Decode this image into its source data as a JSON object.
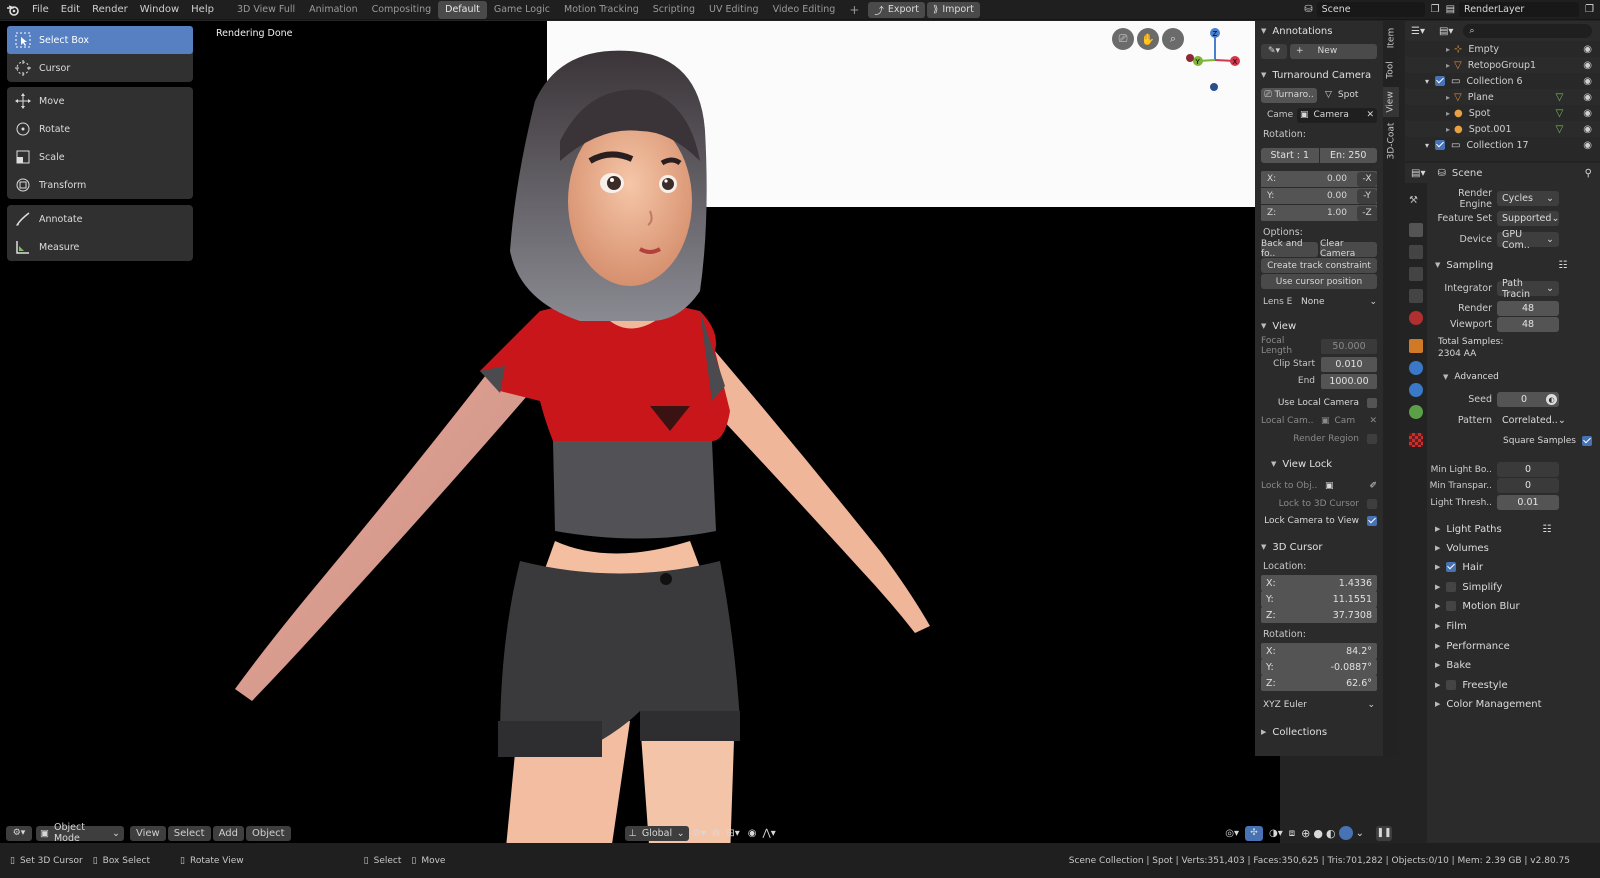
{
  "menu": [
    "File",
    "Edit",
    "Render",
    "Window",
    "Help"
  ],
  "workspaces": [
    {
      "label": "3D View Full",
      "active": false
    },
    {
      "label": "Animation",
      "active": false
    },
    {
      "label": "Compositing",
      "active": false
    },
    {
      "label": "Default",
      "active": true
    },
    {
      "label": "Game Logic",
      "active": false
    },
    {
      "label": "Motion Tracking",
      "active": false
    },
    {
      "label": "Scripting",
      "active": false
    },
    {
      "label": "UV Editing",
      "active": false
    },
    {
      "label": "Video Editing",
      "active": false
    }
  ],
  "topbar": {
    "add_tab": "+",
    "export": "Export",
    "import": "Import",
    "scene": "Scene",
    "render_layer": "RenderLayer"
  },
  "viewport": {
    "status": "Rendering Done"
  },
  "tools": {
    "group1": [
      "Select Box",
      "Cursor"
    ],
    "group2": [
      "Move",
      "Rotate",
      "Scale",
      "Transform"
    ],
    "group3": [
      "Annotate",
      "Measure"
    ]
  },
  "npanel": {
    "annotations": {
      "title": "Annotations",
      "new": "New"
    },
    "turnaround": {
      "title": "Turnaround Camera",
      "obj": "Turnaro..",
      "spot": "Spot",
      "came_label": "Came",
      "camera": "Camera",
      "rotation": "Rotation:",
      "start": "Start : 1",
      "end": "En: 250",
      "rx": {
        "label": "X:",
        "value": "0.00",
        "btn": "-X"
      },
      "ry": {
        "label": "Y:",
        "value": "0.00",
        "btn": "-Y"
      },
      "rz": {
        "label": "Z:",
        "value": "1.00",
        "btn": "-Z"
      },
      "options": "Options:",
      "back": "Back and fo..",
      "clear": "Clear Camera",
      "track": "Create track constraint",
      "cursor": "Use cursor position",
      "lens_label": "Lens E",
      "lens_value": "None"
    },
    "view": {
      "title": "View",
      "focal_label": "Focal Length",
      "focal": "50.000",
      "clip_start_label": "Clip Start",
      "clip_start": "0.010",
      "end_label": "End",
      "end": "1000.00",
      "use_local": "Use Local Camera",
      "local_cam_label": "Local Cam..",
      "local_cam": "Cam",
      "render_region": "Render Region"
    },
    "viewlock": {
      "title": "View Lock",
      "lock_obj": "Lock to Obj..",
      "lock_3d": "Lock to 3D Cursor",
      "lock_cam": "Lock Camera to View"
    },
    "cursor3d": {
      "title": "3D Cursor",
      "location": "Location:",
      "lx": {
        "label": "X:",
        "value": "1.4336"
      },
      "ly": {
        "label": "Y:",
        "value": "11.1551"
      },
      "lz": {
        "label": "Z:",
        "value": "37.7308"
      },
      "rotation": "Rotation:",
      "rx": {
        "label": "X:",
        "value": "84.2°"
      },
      "ry": {
        "label": "Y:",
        "value": "-0.0887°"
      },
      "rz": {
        "label": "Z:",
        "value": "62.6°"
      },
      "mode": "XYZ Euler"
    },
    "collections": {
      "title": "Collections"
    }
  },
  "vtabs": [
    "Item",
    "Tool",
    "View",
    "3D-Coat"
  ],
  "outliner": [
    {
      "name": "Empty",
      "indent": 3,
      "type": "empty"
    },
    {
      "name": "RetopoGroup1",
      "indent": 3,
      "type": "mesh"
    },
    {
      "name": "Collection 6",
      "indent": 1,
      "type": "collection"
    },
    {
      "name": "Plane",
      "indent": 3,
      "type": "mesh"
    },
    {
      "name": "Spot",
      "indent": 3,
      "type": "light"
    },
    {
      "name": "Spot.001",
      "indent": 3,
      "type": "light"
    },
    {
      "name": "Collection 17",
      "indent": 1,
      "type": "collection"
    }
  ],
  "props": {
    "scene": "Scene",
    "render_engine_label": "Render Engine",
    "render_engine": "Cycles",
    "feature_set_label": "Feature Set",
    "feature_set": "Supported",
    "device_label": "Device",
    "device": "GPU Com..",
    "sampling": "Sampling",
    "integrator_label": "Integrator",
    "integrator": "Path Tracin",
    "render_label": "Render",
    "render": "48",
    "viewport_label": "Viewport",
    "viewport": "48",
    "total_samples": "Total Samples:",
    "total_aa": "2304 AA",
    "advanced": "Advanced",
    "seed_label": "Seed",
    "seed": "0",
    "pattern_label": "Pattern",
    "pattern": "Correlated..",
    "square_samples": "Square Samples",
    "min_light_label": "Min Light Bo..",
    "min_light": "0",
    "min_transp_label": "Min Transpar..",
    "min_transp": "0",
    "light_thresh_label": "Light Thresh..",
    "light_thresh": "0.01",
    "sections": [
      "Light Paths",
      "Volumes",
      "Hair",
      "Simplify",
      "Motion Blur",
      "Film",
      "Performance",
      "Bake",
      "Freestyle",
      "Color Management"
    ]
  },
  "vpbar": {
    "mode": "Object Mode",
    "view": "View",
    "select": "Select",
    "add": "Add",
    "object": "Object",
    "orientation": "Global"
  },
  "status": {
    "set_cursor": "Set 3D Cursor",
    "box_select": "Box Select",
    "rotate_view": "Rotate View",
    "select": "Select",
    "move": "Move",
    "info": "Scene Collection | Spot | Verts:351,403 | Faces:350,625 | Tris:701,282 | Objects:0/10 | Mem: 2.39 GB | v2.80.75"
  }
}
